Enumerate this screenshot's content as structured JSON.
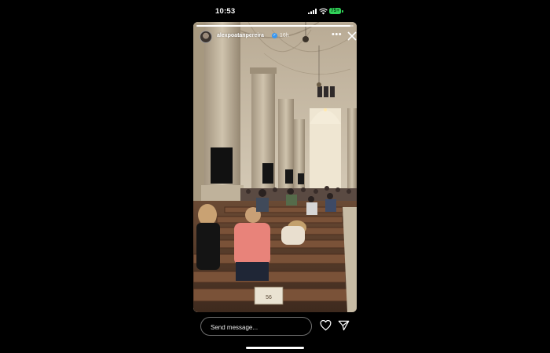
{
  "status_bar": {
    "time": "10:53",
    "battery": "75+"
  },
  "story": {
    "username": "alexpoatanpereira",
    "time_ago": "16h",
    "progress": 0.98,
    "image_description": "Interior of a gothic cathedral nave with people standing in wooden pews",
    "pew_plaque": "56"
  },
  "reply_bar": {
    "placeholder": "Send message..."
  },
  "icons": {
    "more": "more-icon",
    "close": "close-icon",
    "like": "heart-icon",
    "share": "send-icon"
  }
}
